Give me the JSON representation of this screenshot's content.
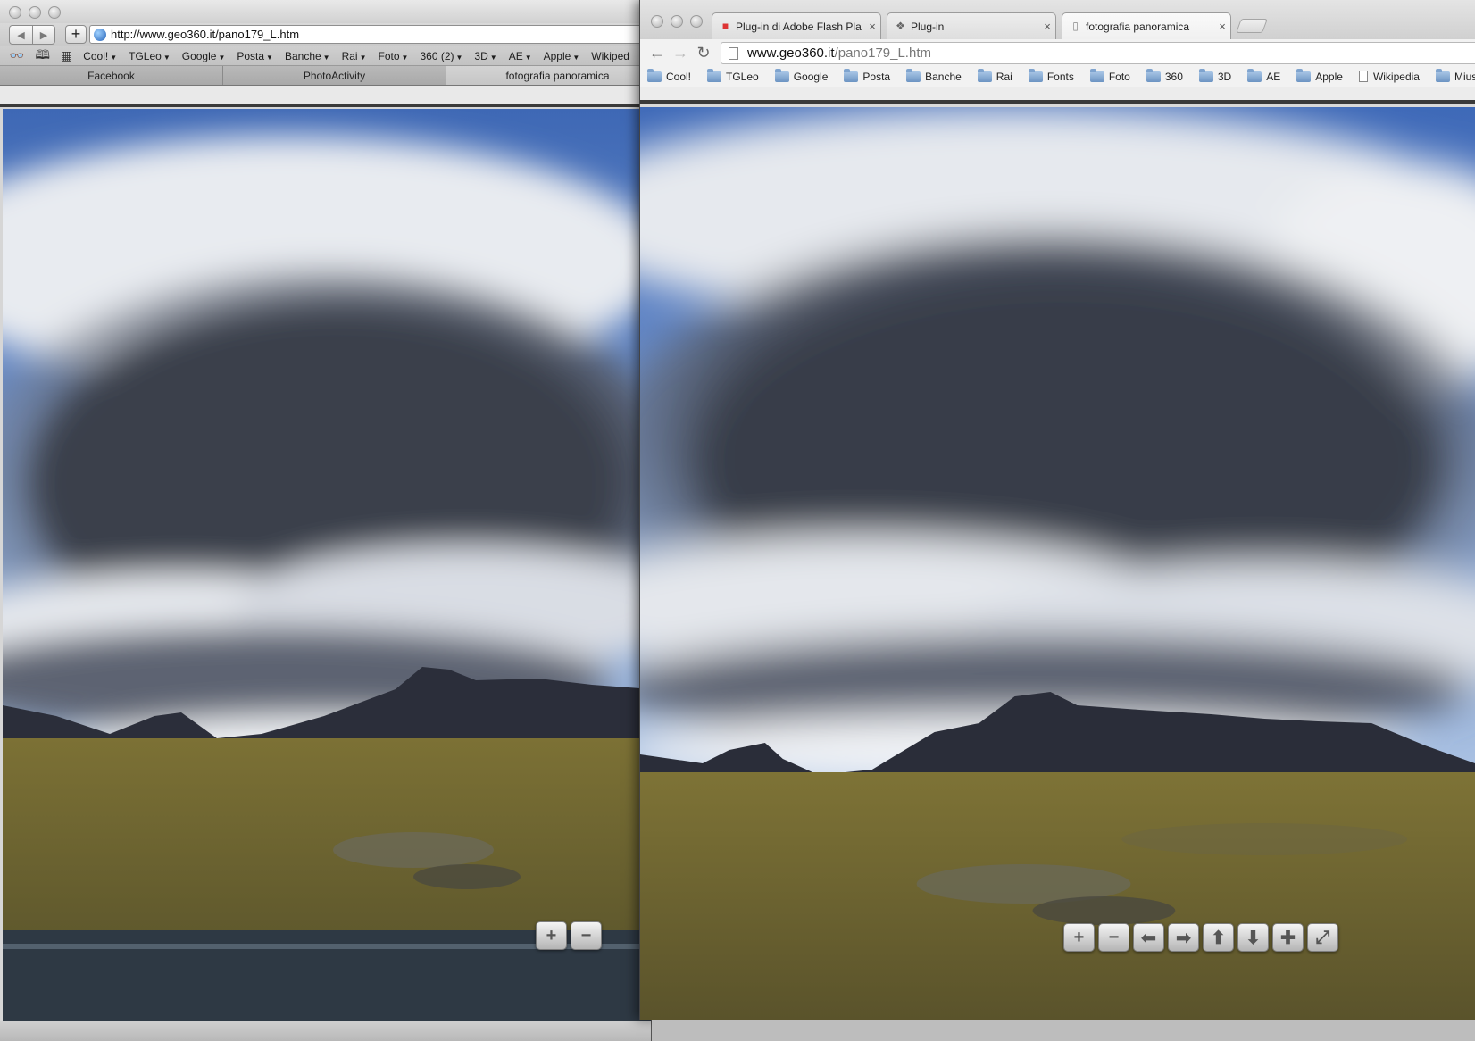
{
  "left_browser": {
    "url": "http://www.geo360.it/pano179_L.htm",
    "bookmarks": [
      "Cool!",
      "TGLeo",
      "Google",
      "Posta",
      "Banche",
      "Rai",
      "Foto",
      "360 (2)",
      "3D",
      "AE",
      "Apple",
      "Wikiped"
    ],
    "tabs": [
      "Facebook",
      "PhotoActivity",
      "fotografia panoramica"
    ],
    "active_tab": "fotografia panoramica"
  },
  "right_browser": {
    "tabs": [
      {
        "title": "Plug-in di Adobe Flash Pla",
        "icon": "google-icon"
      },
      {
        "title": "Plug-in",
        "icon": "puzzle-icon"
      },
      {
        "title": "fotografia panoramica",
        "icon": "page-icon"
      }
    ],
    "active_tab": "fotografia panoramica",
    "url_domain": "www.geo360.it",
    "url_path": "/pano179_L.htm",
    "bookmarks": [
      {
        "label": "Cool!",
        "type": "folder"
      },
      {
        "label": "TGLeo",
        "type": "folder"
      },
      {
        "label": "Google",
        "type": "folder"
      },
      {
        "label": "Posta",
        "type": "folder"
      },
      {
        "label": "Banche",
        "type": "folder"
      },
      {
        "label": "Rai",
        "type": "folder"
      },
      {
        "label": "Fonts",
        "type": "folder"
      },
      {
        "label": "Foto",
        "type": "folder"
      },
      {
        "label": "360",
        "type": "folder"
      },
      {
        "label": "3D",
        "type": "folder"
      },
      {
        "label": "AE",
        "type": "folder"
      },
      {
        "label": "Apple",
        "type": "folder"
      },
      {
        "label": "Wikipedia",
        "type": "page"
      },
      {
        "label": "Miusic",
        "type": "folder"
      }
    ]
  },
  "pano_controls": [
    "zoom-in-icon",
    "zoom-out-icon",
    "pan-left-icon",
    "pan-right-icon",
    "pan-up-icon",
    "pan-down-icon",
    "move-icon",
    "fullscreen-icon"
  ],
  "colors": {
    "sky": "#3d67b3",
    "cloud_dark": "#3b4150",
    "cloud_light": "#dfe3ea",
    "mountain": "#2c2f3c",
    "grass": "#8b7a3a"
  }
}
